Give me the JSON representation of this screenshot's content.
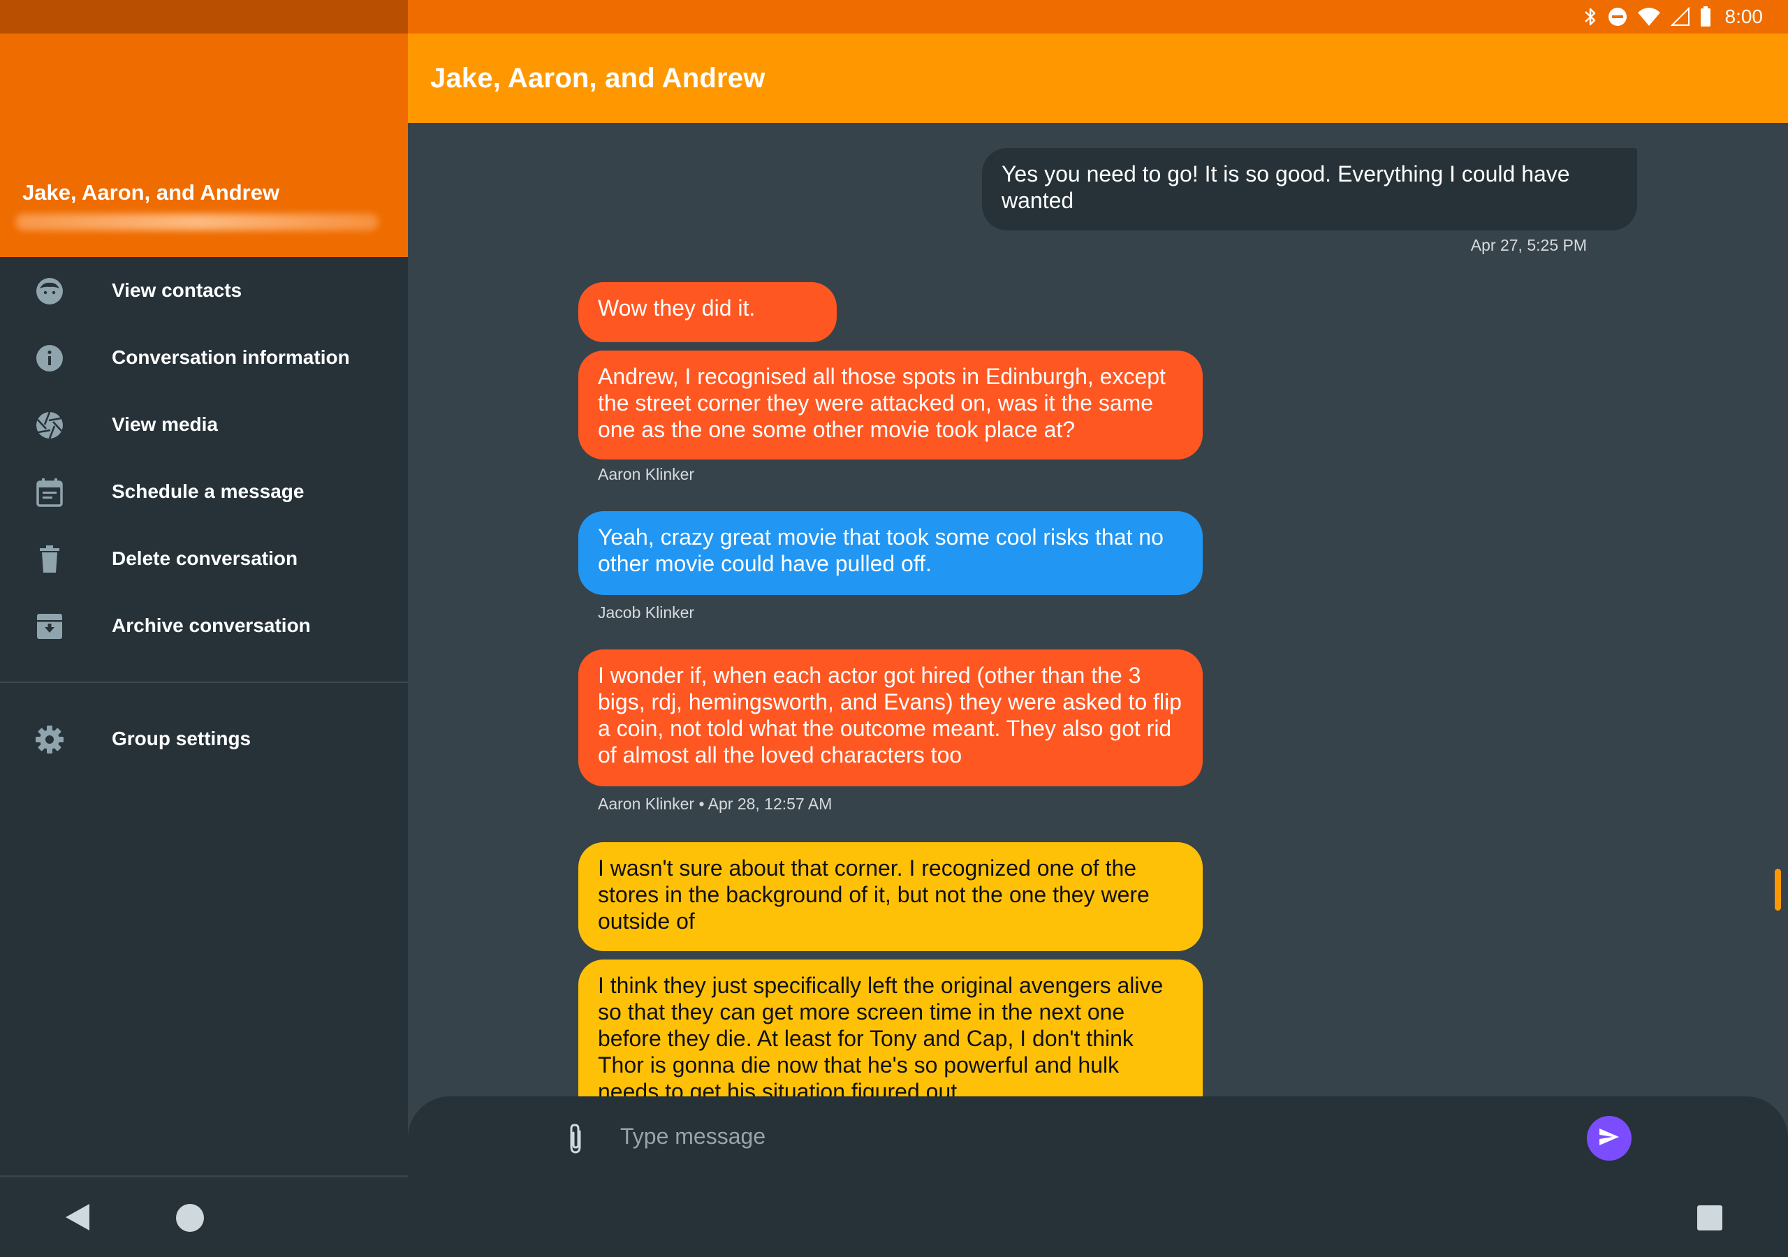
{
  "status_bar": {
    "time": "8:00",
    "icons": [
      "bluetooth-icon",
      "do-not-disturb-icon",
      "wifi-icon",
      "cell-signal-icon",
      "battery-icon"
    ]
  },
  "drawer": {
    "title": "Jake, Aaron, and Andrew",
    "items": [
      {
        "label": "View contacts",
        "icon": "face-icon"
      },
      {
        "label": "Conversation information",
        "icon": "info-icon"
      },
      {
        "label": "View media",
        "icon": "camera-shutter-icon"
      },
      {
        "label": "Schedule a message",
        "icon": "calendar-icon"
      },
      {
        "label": "Delete conversation",
        "icon": "trash-icon"
      },
      {
        "label": "Archive conversation",
        "icon": "archive-icon"
      }
    ],
    "settings_item": {
      "label": "Group settings",
      "icon": "gear-icon"
    }
  },
  "toolbar": {
    "title": "Jake, Aaron, and Andrew"
  },
  "messages": [
    {
      "text": "Yes you need to go! It is so good. Everything I could have wanted",
      "direction": "out",
      "color": "#263238"
    },
    {
      "text": "Apr 27, 5:25 PM",
      "kind": "caption"
    },
    {
      "text": "Wow they did it.",
      "direction": "in",
      "color": "#ff5722"
    },
    {
      "text": "Andrew, I recognised all those spots in Edinburgh, except the street corner they were attacked on, was it the same one as the one some other movie took place at?",
      "direction": "in",
      "color": "#ff5722"
    },
    {
      "text": "Aaron Klinker",
      "kind": "caption"
    },
    {
      "text": "Yeah, crazy great movie that took some cool risks that no other movie could have pulled off.",
      "direction": "in",
      "color": "#2196f3"
    },
    {
      "text": "Jacob Klinker",
      "kind": "caption"
    },
    {
      "text": "I wonder if, when each actor got hired (other than the 3 bigs, rdj, hemingsworth, and Evans) they were asked to flip a coin, not told what the outcome meant. They also got rid of almost all the loved characters too",
      "direction": "in",
      "color": "#ff5722"
    },
    {
      "text": "Aaron Klinker • Apr 28, 12:57 AM",
      "kind": "caption"
    },
    {
      "text": "I wasn't sure about that corner. I recognized one of the stores in the background of it, but not the one they were outside of",
      "direction": "in",
      "color": "#ffc107"
    },
    {
      "text": "I think they just specifically left the original avengers alive so that they can get more screen time in the next one before they die. At least for Tony and Cap, I don't think Thor is gonna die now that he's so powerful and hulk needs to get his situation figured out",
      "direction": "in",
      "color": "#ffc107"
    }
  ],
  "composer": {
    "placeholder": "Type message",
    "value": "",
    "attach_icon": "paperclip-icon",
    "send_icon": "send-icon",
    "send_color": "#7c4dff"
  },
  "navigation": {
    "back_icon": "back-triangle-icon",
    "home_icon": "home-circle-icon",
    "recents_icon": "recents-square-icon"
  },
  "colors": {
    "accent_dark": "#ef6c00",
    "accent": "#ff9800",
    "background": "#37434b",
    "surface": "#263238"
  }
}
